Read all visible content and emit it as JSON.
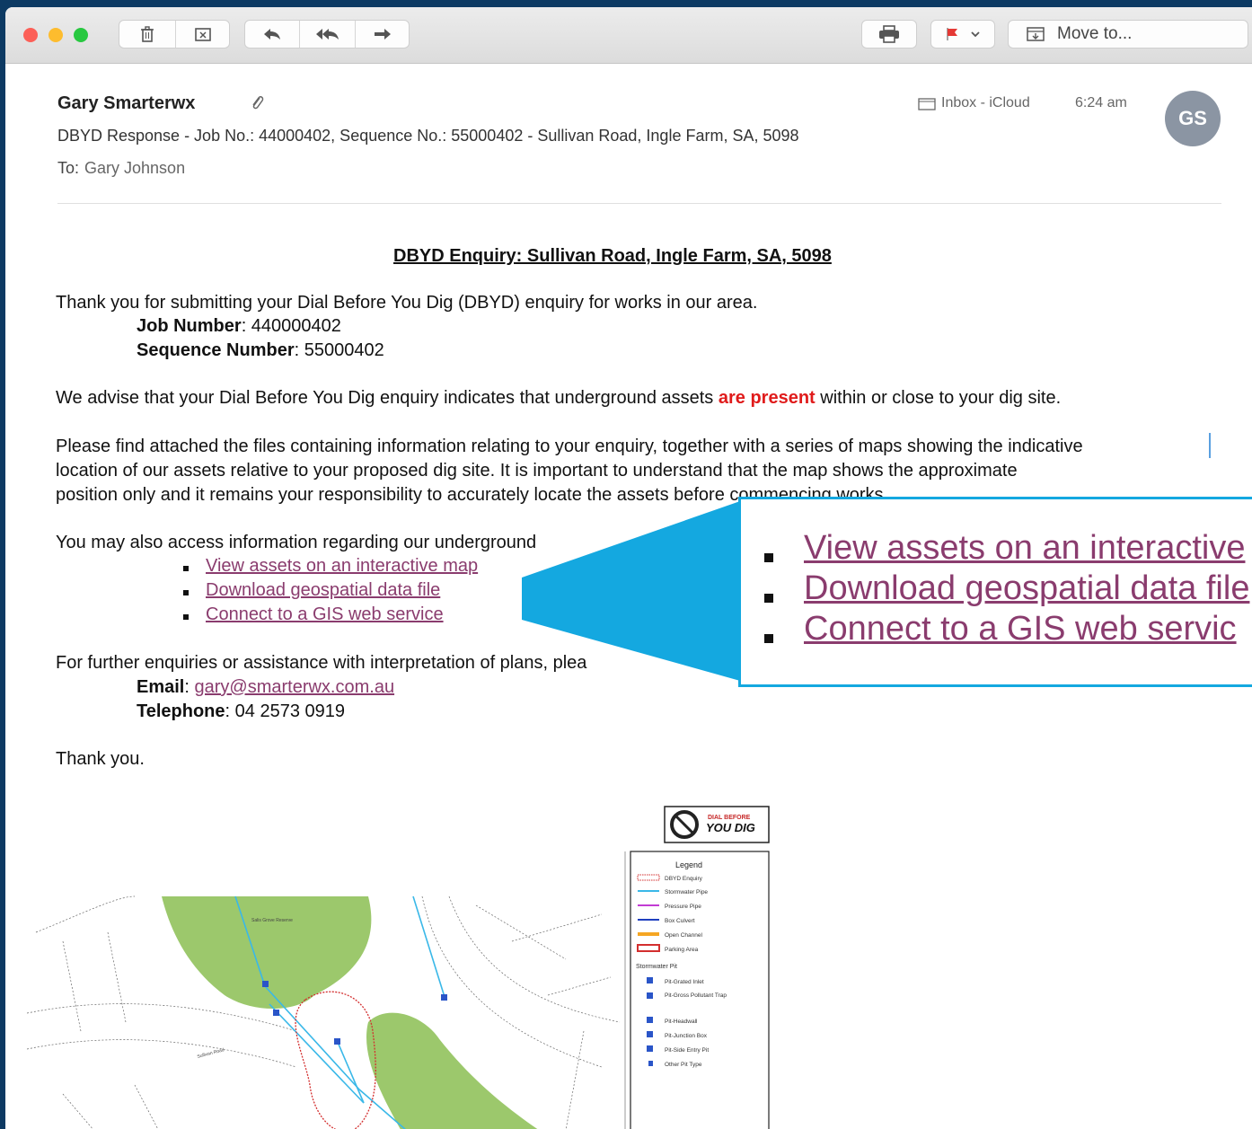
{
  "toolbar": {
    "traffic_lights": [
      "#fc5f57",
      "#fdbc2e",
      "#28c840"
    ],
    "move_to_label": "Move to..."
  },
  "header": {
    "sender": "Gary Smarterwx",
    "subject": "DBYD Response - Job No.: 44000402, Sequence No.: 55000402 - Sullivan Road, Ingle Farm, SA, 5098",
    "to_label": "To:",
    "to_value": "Gary Johnson",
    "mailbox": "Inbox - iCloud",
    "time": "6:24 am",
    "avatar_initials": "GS"
  },
  "body": {
    "heading": "DBYD Enquiry: Sullivan Road, Ingle Farm, SA, 5098",
    "intro": "Thank you for submitting your Dial Before You Dig (DBYD) enquiry for works in our area.",
    "job_label": "Job Number",
    "job_value": ": 440000402",
    "seq_label": "Sequence Number",
    "seq_value": ": 55000402",
    "advise_pre": "We advise that your Dial Before You Dig enquiry indicates that underground assets ",
    "advise_red": "are present",
    "advise_post": " within or close to your dig site.",
    "para2_line1": "Please find attached the files containing information relating to your enquiry, together with a series of maps showing the indicative",
    "para2_line2": "location of our assets relative to your proposed dig site. It is important to understand that the map shows the approximate",
    "para2_line3": "position only and it remains your responsibility to accurately locate the assets before commencing works.",
    "access_text": "You may also access information regarding our underground",
    "links": [
      "View assets on an interactive map",
      "Download geospatial data file",
      "Connect to a GIS web service"
    ],
    "further_text": "For further enquiries or assistance with interpretation of plans, plea",
    "email_label": "Email",
    "email_value": "gary@smarterwx.com.au",
    "tel_label": "Telephone",
    "tel_value": ": 04 2573 0919",
    "thanks": "Thank you."
  },
  "callout": {
    "links": [
      "View assets on an interactive",
      "Download geospatial data file",
      "Connect to a GIS web servic"
    ],
    "accent": "#14a8e0"
  },
  "map": {
    "logo_line1": "DIAL BEFORE",
    "logo_line2": "YOU DIG",
    "legend_title": "Legend",
    "legend_items": [
      "DBYD Enquiry",
      "Stormwater Pipe",
      "Pressure Pipe",
      "Box Culvert",
      "Open Channel",
      "Parking Area"
    ],
    "pits_title": "Stormwater Pit",
    "pit_items": [
      "Pit-Grated Inlet",
      "Pit-Gross Pollutant Trap",
      "Pit-Headwall",
      "Pit-Junction Box",
      "Pit-Side Entry Pit",
      "Other Pit Type"
    ],
    "street_labels": [
      "Salis Grove Reserve",
      "Sullivan Road"
    ]
  },
  "colors": {
    "link": "#8a3c6e",
    "present": "#e01b1b",
    "park": "#9cc86c",
    "pipe": "#3ab8e8"
  }
}
